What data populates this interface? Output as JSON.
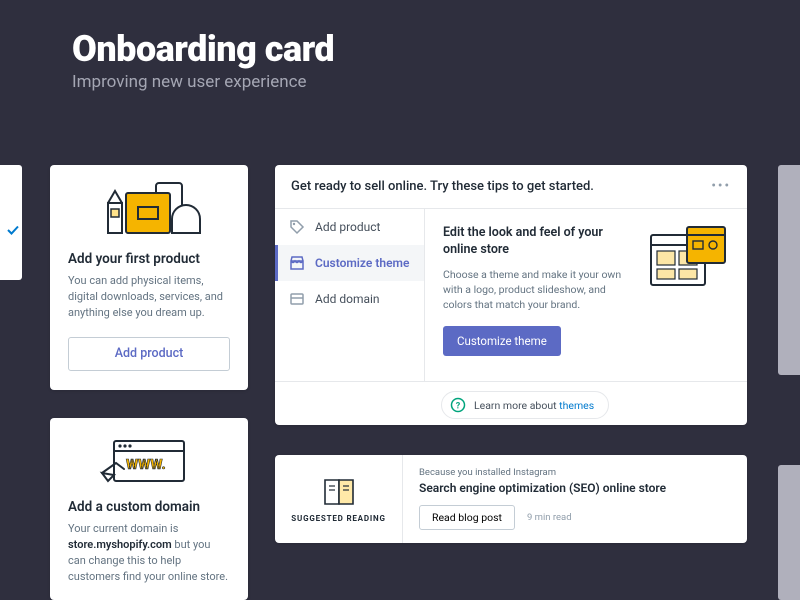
{
  "hero": {
    "title": "Onboarding card",
    "subtitle": "Improving new user experience"
  },
  "card_product": {
    "title": "Add your first product",
    "body": "You can add physical items, digital downloads, services, and anything else you dream up.",
    "button": "Add product"
  },
  "card_domain": {
    "title": "Add a custom domain",
    "body_pre": "Your current domain is ",
    "body_bold": "store.myshopify.com",
    "body_post": " but you can change this to help customers find your online store."
  },
  "onboard": {
    "header": "Get ready to sell online. Try these tips to get started.",
    "tabs": [
      "Add product",
      "Customize theme",
      "Add domain"
    ],
    "pane": {
      "title": "Edit the look and feel of your online store",
      "body": "Choose a theme and make it your own with a logo, product slideshow, and colors that match your brand.",
      "button": "Customize theme"
    },
    "learn_pre": "Learn more about ",
    "learn_link": "themes"
  },
  "reading": {
    "label": "SUGGESTED READING",
    "pre": "Because you installed Instagram",
    "title": "Search engine optimization (SEO) online store",
    "button": "Read blog post",
    "time": "9 min read"
  }
}
